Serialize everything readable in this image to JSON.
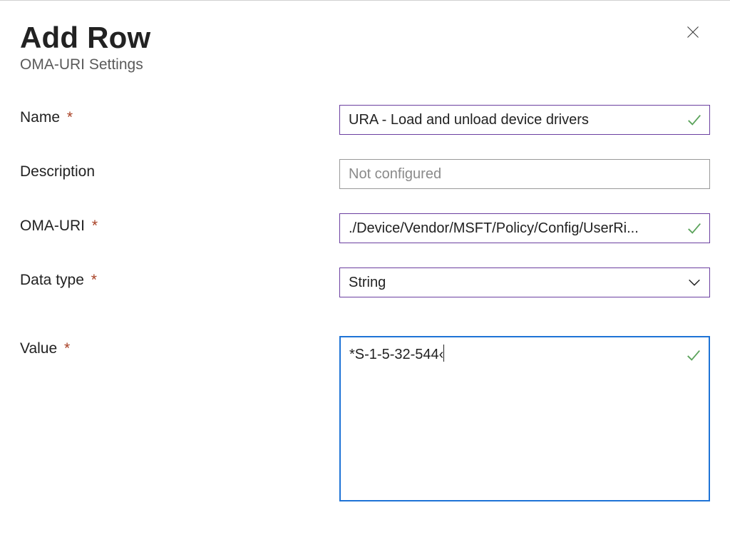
{
  "header": {
    "title": "Add Row",
    "subtitle": "OMA-URI Settings"
  },
  "form": {
    "name": {
      "label": "Name",
      "required": true,
      "value": "URA - Load and unload device drivers",
      "valid": true
    },
    "description": {
      "label": "Description",
      "required": false,
      "placeholder": "Not configured",
      "value": ""
    },
    "oma_uri": {
      "label": "OMA-URI",
      "required": true,
      "value": "./Device/Vendor/MSFT/Policy/Config/UserRi...",
      "valid": true
    },
    "data_type": {
      "label": "Data type",
      "required": true,
      "value": "String"
    },
    "value": {
      "label": "Value",
      "required": true,
      "value": "*S-1-5-32-544‹",
      "valid": true
    },
    "required_marker": "*"
  },
  "colors": {
    "required": "#a84024",
    "validated_border": "#6b3fa0",
    "focus_border": "#1e73d6",
    "check": "#5ba35b"
  }
}
